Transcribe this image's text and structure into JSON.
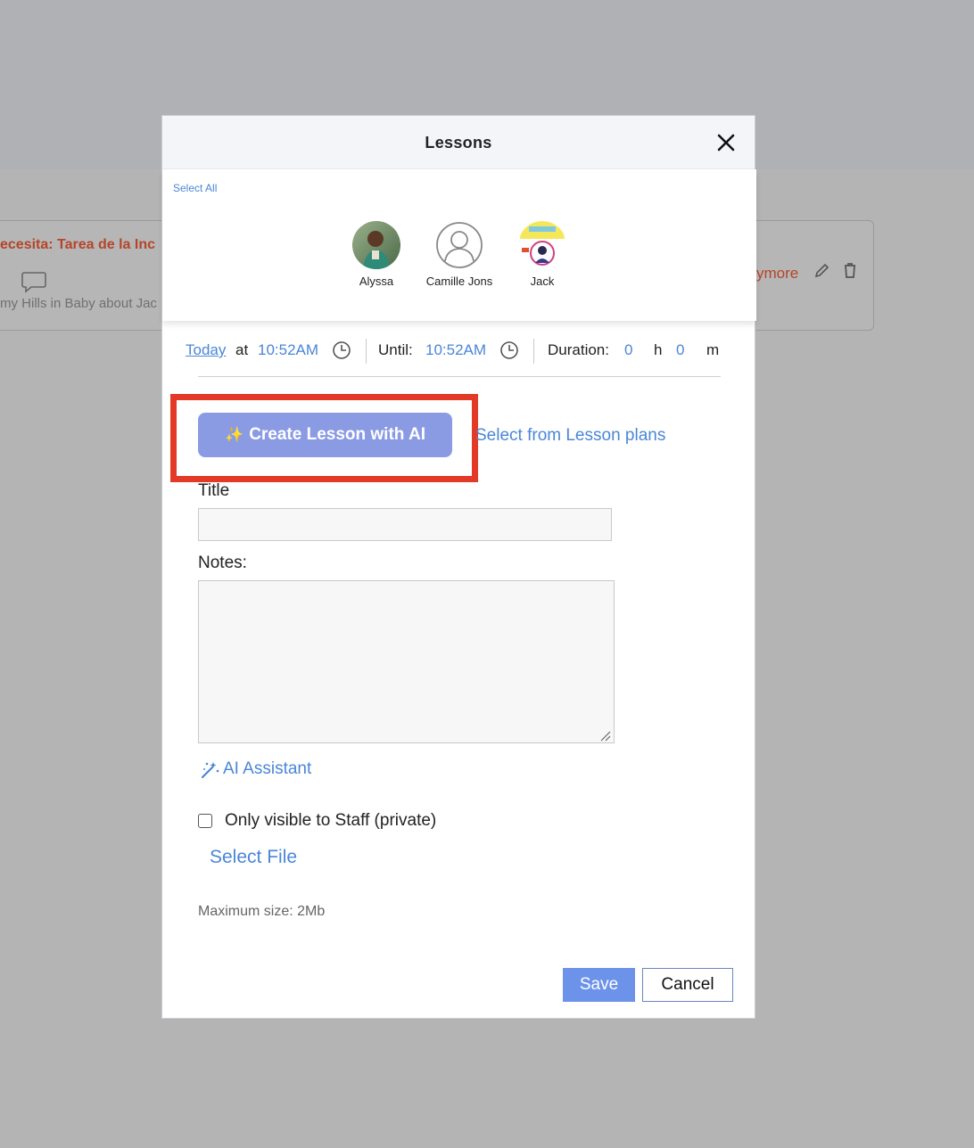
{
  "background": {
    "card_title": "ecesita: Tarea de la Inc",
    "card_subtitle": "my Hills in Baby about Jac",
    "card_more": "ymore"
  },
  "modal": {
    "title": "Lessons",
    "select_all": "Select All",
    "students": [
      {
        "name": "Alyssa",
        "avatar": "photo"
      },
      {
        "name": "Camille Jons",
        "avatar": "person-placeholder-icon"
      },
      {
        "name": "Jack",
        "avatar": "badge-photo"
      }
    ],
    "time": {
      "day_link": "Today",
      "at_label": "at",
      "start_time": "10:52AM",
      "until_label": "Until:",
      "end_time": "10:52AM",
      "duration_label": "Duration:",
      "hours_value": "0",
      "hours_unit": "h",
      "minutes_value": "0",
      "minutes_unit": "m"
    },
    "ai_button_label": "Create Lesson with AI",
    "ai_button_sparkle": "✨",
    "lesson_plans_link": "Select from Lesson plans",
    "title_label": "Title",
    "title_value": "",
    "notes_label": "Notes:",
    "notes_value": "",
    "ai_assistant_label": "AI Assistant",
    "private_label": "Only visible to Staff (private)",
    "private_checked": false,
    "select_file_label": "Select File",
    "max_size_label": "Maximum size: 2Mb",
    "save_label": "Save",
    "cancel_label": "Cancel"
  },
  "colors": {
    "accent_blue": "#4a86d8",
    "ai_button": "#8a9be4",
    "save_button": "#6c92ea",
    "highlight_box": "#e23a26",
    "bg_card_text": "#b5452a"
  }
}
